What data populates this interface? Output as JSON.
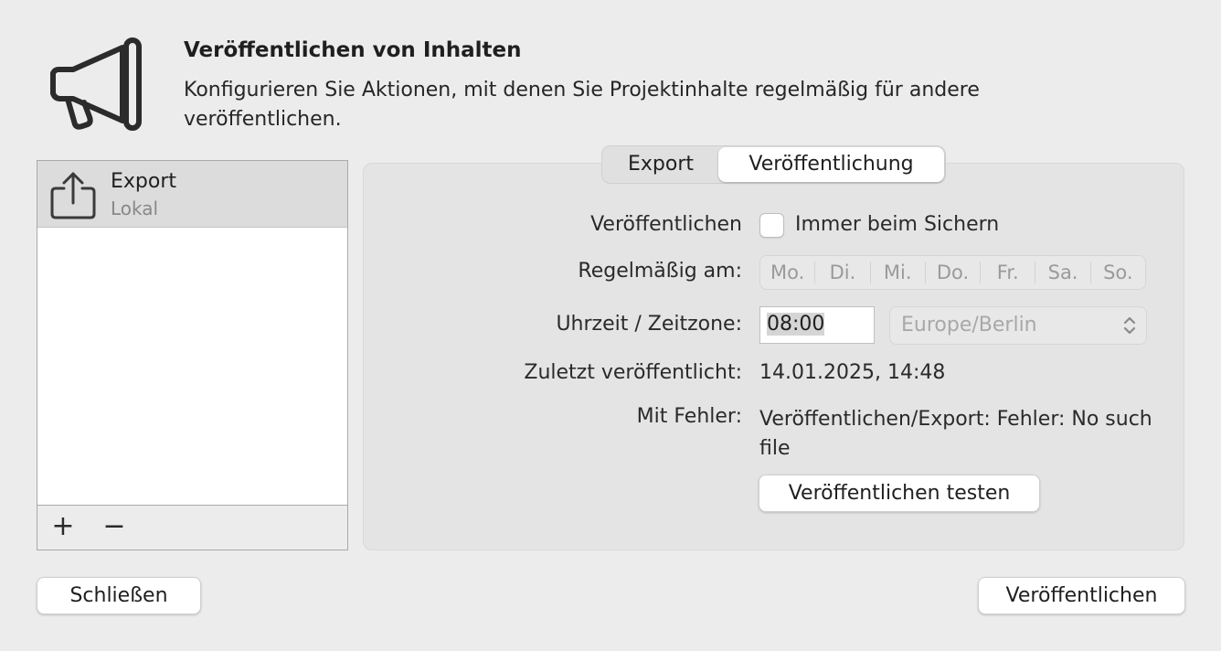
{
  "header": {
    "icon": "megaphone-icon",
    "title": "Veröffentlichen von Inhalten",
    "description": "Konfigurieren Sie Aktionen, mit denen Sie Projektinhalte regelmäßig für andere veröffentlichen."
  },
  "list": {
    "items": [
      {
        "icon": "share-export-icon",
        "title": "Export",
        "subtitle": "Lokal"
      }
    ],
    "add_label": "+",
    "remove_label": "−"
  },
  "tabs": [
    {
      "label": "Export",
      "selected": false
    },
    {
      "label": "Veröffentlichung",
      "selected": true
    }
  ],
  "form": {
    "publish_label": "Veröffentlichen",
    "always_on_save_label": "Immer beim Sichern",
    "always_on_save_checked": false,
    "regular_label": "Regelmäßig am:",
    "days": [
      "Mo.",
      "Di.",
      "Mi.",
      "Do.",
      "Fr.",
      "Sa.",
      "So."
    ],
    "time_label": "Uhrzeit / Zeitzone:",
    "time_value": "08:00",
    "timezone_value": "Europe/Berlin",
    "last_published_label": "Zuletzt veröffentlicht:",
    "last_published_value": "14.01.2025, 14:48",
    "error_label": "Mit Fehler:",
    "error_value": "Veröffentlichen/Export: Fehler: No such file",
    "test_button": "Veröffentlichen testen"
  },
  "footer": {
    "close_button": "Schließen",
    "publish_button": "Veröffentlichen"
  }
}
